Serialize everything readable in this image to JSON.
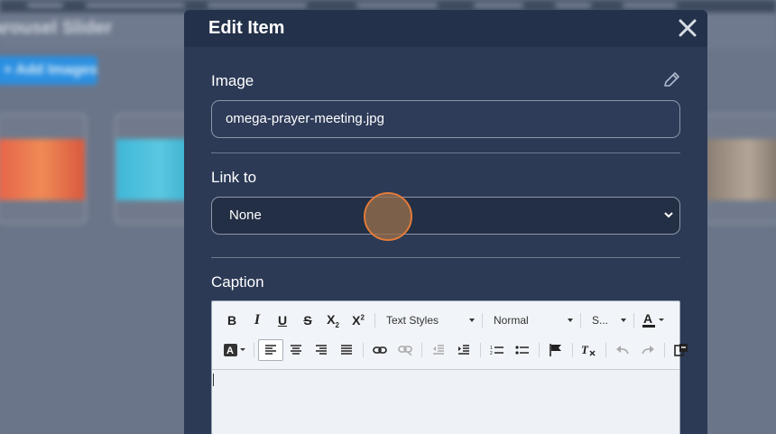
{
  "background": {
    "title": "arousel Slider",
    "add_images_label": "+ Add Images"
  },
  "modal": {
    "title": "Edit Item",
    "image": {
      "label": "Image",
      "value": "omega-prayer-meeting.jpg"
    },
    "link": {
      "label": "Link to",
      "selected": "None"
    },
    "caption": {
      "label": "Caption",
      "toolbar": {
        "text_styles": "Text Styles",
        "format": "Normal",
        "size": "S..."
      },
      "content": ""
    }
  },
  "colors": {
    "modal_bg": "#2c3a56",
    "modal_header": "#23314a",
    "accent_blue": "#2b8fe0"
  }
}
